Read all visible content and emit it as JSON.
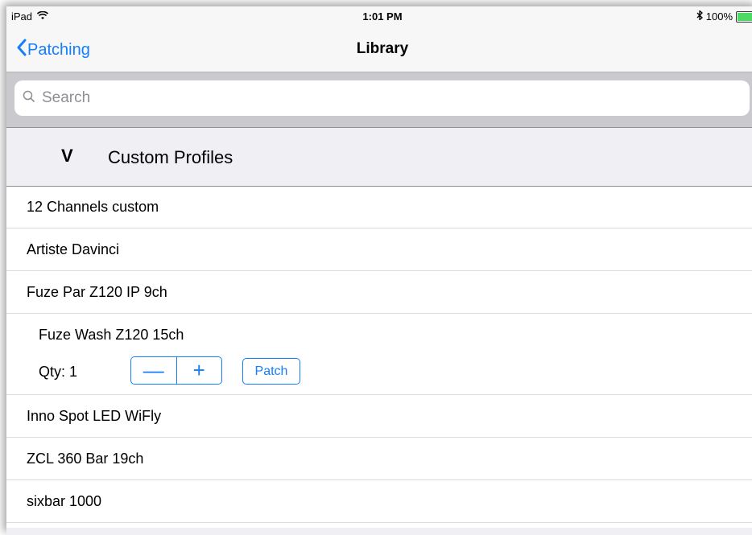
{
  "status": {
    "device": "iPad",
    "time": "1:01 PM",
    "battery": "100%",
    "battery_level": 1.0
  },
  "nav": {
    "back_label": "Patching",
    "title": "Library"
  },
  "search": {
    "placeholder": "Search"
  },
  "section": {
    "toggle": "V",
    "label": "Custom Profiles"
  },
  "items": [
    {
      "label": "12 Channels custom"
    },
    {
      "label": "Artiste Davinci"
    },
    {
      "label": "Fuze Par Z120 IP 9ch"
    },
    {
      "label": "Fuze Wash Z120 15ch",
      "qty_label": "Qty: 1",
      "minus": "—",
      "plus": "+",
      "patch_label": "Patch"
    },
    {
      "label": "Inno Spot LED WiFly"
    },
    {
      "label": "ZCL 360 Bar 19ch"
    },
    {
      "label": "sixbar 1000"
    }
  ],
  "colors": {
    "accent": "#157efb",
    "battery": "#4cd964"
  }
}
